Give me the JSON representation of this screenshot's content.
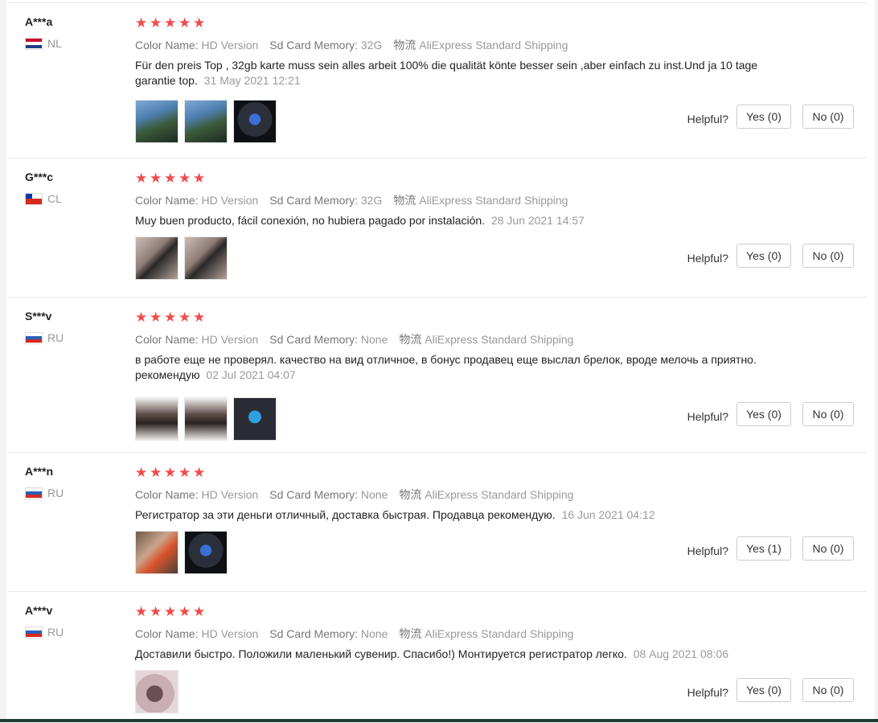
{
  "attr_labels": {
    "color": "Color Name:",
    "sd": "Sd Card Memory:",
    "ship": "物流"
  },
  "helpful_label": "Helpful?",
  "star_color": "#f24a4a",
  "reviews": [
    {
      "user": "A***a",
      "country": "NL",
      "stars": 5,
      "color": "HD Version",
      "sd": "32G",
      "ship": "AliExpress Standard Shipping",
      "text": "Für den preis Top , 32gb karte muss sein alles arbeit 100% die qualität könte besser sein ,aber einfach zu inst.Und ja 10 tage garantie top.",
      "date": "31 May 2021 12:21",
      "photos": [
        "dashcam-outdoor-photo",
        "dashcam-outdoor-photo",
        "car-screen-photo"
      ],
      "yes": "Yes (0)",
      "no": "No (0)"
    },
    {
      "user": "G***c",
      "country": "CL",
      "stars": 5,
      "color": "HD Version",
      "sd": "32G",
      "ship": "AliExpress Standard Shipping",
      "text": "Muy buen producto, fácil conexión, no hubiera pagado por instalación.",
      "date": "28 Jun 2021 14:57",
      "photos": [
        "usb-dashcam-photo",
        "usb-dashcam-photo"
      ],
      "yes": "Yes (0)",
      "no": "No (0)"
    },
    {
      "user": "S***v",
      "country": "RU",
      "stars": 5,
      "color": "HD Version",
      "sd": "None",
      "ship": "AliExpress Standard Shipping",
      "text": "в работе еще не проверял. качество на вид отличное, в бонус продавец еще выслал брелок, вроде мелочь а приятно. рекомендую",
      "date": "02 Jul 2021 04:07",
      "photos": [
        "dashcam-photo",
        "dashcam-photo",
        "keychain-photo"
      ],
      "yes": "Yes (0)",
      "no": "No (0)"
    },
    {
      "user": "A***n",
      "country": "RU",
      "stars": 5,
      "color": "HD Version",
      "sd": "None",
      "ship": "AliExpress Standard Shipping",
      "text": "Регистратор за эти деньги отличный, доставка быстрая. Продавца рекомендую.",
      "date": "16 Jun 2021 04:12",
      "photos": [
        "dashcam-hand-photo",
        "car-screen-photo"
      ],
      "yes": "Yes (1)",
      "no": "No (0)"
    },
    {
      "user": "A***v",
      "country": "RU",
      "stars": 5,
      "color": "HD Version",
      "sd": "None",
      "ship": "AliExpress Standard Shipping",
      "text": "Доставили быстро. Положили маленький сувенир. Спасибо!) Монтируется регистратор легко.",
      "date": "08 Aug 2021 08:06",
      "photos": [
        "souvenir-photo"
      ],
      "yes": "Yes (0)",
      "no": "No (0)"
    }
  ]
}
